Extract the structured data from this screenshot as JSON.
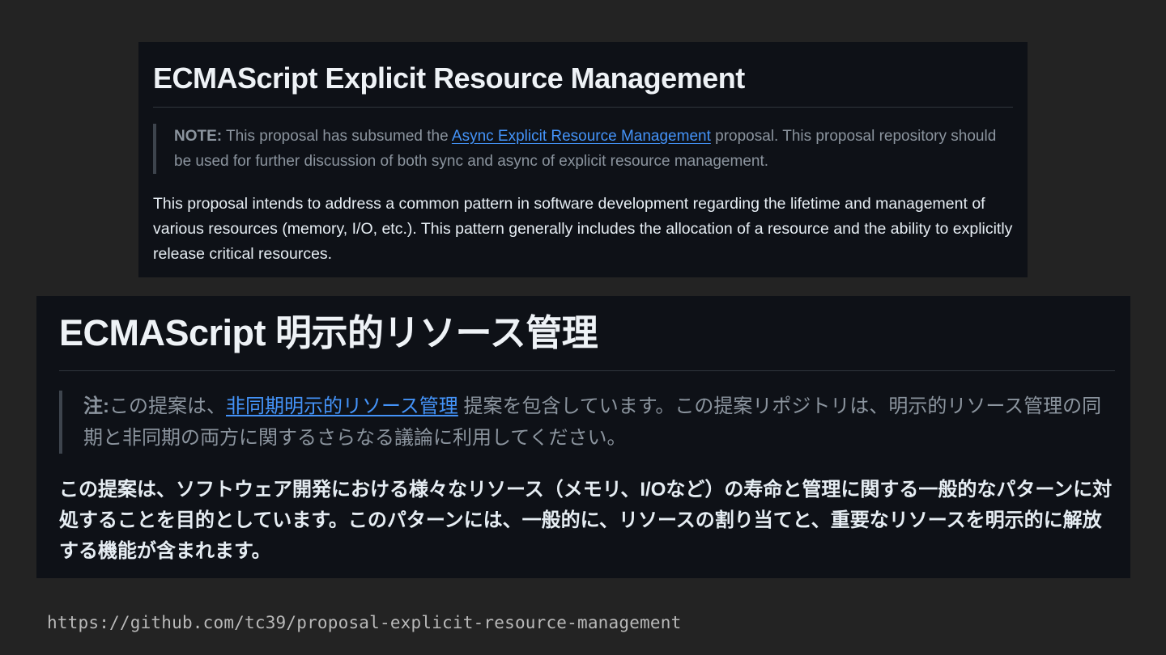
{
  "english": {
    "title": "ECMAScript Explicit Resource Management",
    "note_label": "NOTE:",
    "note_before": " This proposal has subsumed the ",
    "note_link": "Async Explicit Resource Management",
    "note_after": " proposal. This proposal repository should be used for further discussion of both sync and async of explicit resource management.",
    "body": "This proposal intends to address a common pattern in software development regarding the lifetime and management of various resources (memory, I/O, etc.). This pattern generally includes the allocation of a resource and the ability to explicitly release critical resources."
  },
  "japanese": {
    "title": "ECMAScript 明示的リソース管理",
    "note_label": "注:",
    "note_before": "この提案は、",
    "note_link": "非同期明示的リソース管理",
    "note_after": " 提案を包含しています。この提案リポジトリは、明示的リソース管理の同期と非同期の両方に関するさらなる議論に利用してください。",
    "body": "この提案は、ソフトウェア開発における様々なリソース（メモリ、I/Oなど）の寿命と管理に関する一般的なパターンに対処することを目的としています。このパターンには、一般的に、リソースの割り当てと、重要なリソースを明示的に解放する機能が含まれます。"
  },
  "source_url": "https://github.com/tc39/proposal-explicit-resource-management"
}
